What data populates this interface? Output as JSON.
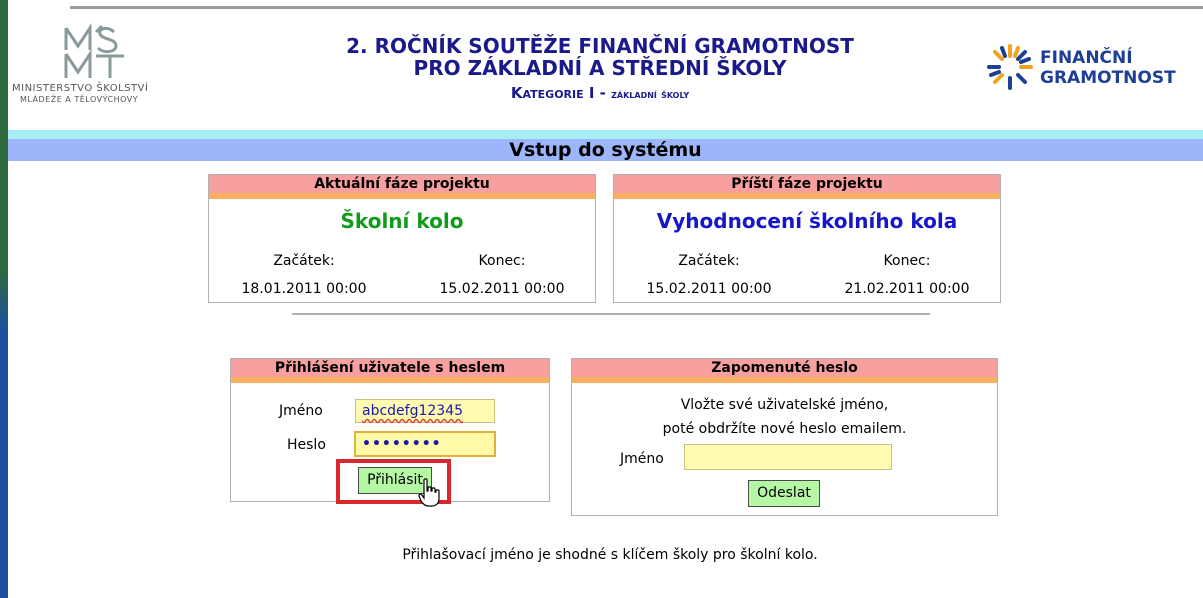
{
  "header": {
    "msmt_logo_line1": "MINISTERSTVO ŠKOLSTVÍ",
    "msmt_logo_line2": "MLÁDEŽE A TĚLOVÝCHOVY",
    "title_line1": "2. ROČNÍK SOUTĚŽE FINANČNÍ GRAMOTNOST",
    "title_line2": "PRO ZÁKLADNÍ A STŘEDNÍ ŠKOLY",
    "category_big": "Kategorie I",
    "category_dash": " - ",
    "category_small": "základní školy",
    "fg_logo_line1": "FINANČNÍ",
    "fg_logo_line2": "GRAMOTNOST"
  },
  "banner": {
    "title": "Vstup do systému"
  },
  "current_phase": {
    "heading": "Aktuální fáze projektu",
    "name": "Školní kolo",
    "start_label": "Začátek:",
    "end_label": "Konec:",
    "start_value": "18.01.2011 00:00",
    "end_value": "15.02.2011 00:00"
  },
  "next_phase": {
    "heading": "Příští fáze projektu",
    "name": "Vyhodnocení školního kola",
    "start_label": "Začátek:",
    "end_label": "Konec:",
    "start_value": "15.02.2011 00:00",
    "end_value": "21.02.2011 00:00"
  },
  "login": {
    "heading": "Přihlášení uživatele s heslem",
    "username_label": "Jméno",
    "username_value": "abcdefg12345",
    "password_label": "Heslo",
    "password_value": "••••••••",
    "submit_label": "Přihlásit"
  },
  "forgot": {
    "heading": "Zapomenuté heslo",
    "line1": "Vložte své uživatelské jméno,",
    "line2": "poté obdržíte nové heslo emailem.",
    "username_label": "Jméno",
    "username_value": "",
    "submit_label": "Odeslat"
  },
  "footer": {
    "note": "Přihlašovací jméno je shodné s klíčem školy pro školní kolo."
  },
  "colors": {
    "panel_header": "#f8a0a0",
    "panel_header_stripe": "#f9b161",
    "banner": "#9db6fb",
    "banner_top": "#a8ecf4",
    "button": "#b6f7a6",
    "input": "#fffbb0",
    "highlight": "#d8282e",
    "title_text": "#1a1a8a",
    "phase_current": "#119b1b",
    "phase_next": "#1616c8"
  },
  "icons": [
    "msmt-logo-icon",
    "financni-gramotnost-star-icon",
    "hand-pointer-cursor-icon"
  ]
}
